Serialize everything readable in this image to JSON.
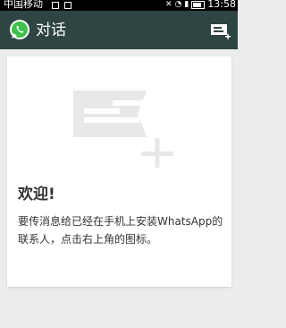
{
  "status_bar": {
    "carrier": "中国移动",
    "time": "13:58"
  },
  "app_bar": {
    "title": "对话",
    "logo_icon": "whatsapp-logo-icon",
    "new_chat_icon": "new-chat-icon",
    "accent_color": "#2f4543"
  },
  "welcome": {
    "title": "欢迎!",
    "body": "要传消息给已经在手机上安装WhatsApp的联系人，点击右上角的图标。",
    "illustration_icon": "new-message-illustration-icon"
  }
}
